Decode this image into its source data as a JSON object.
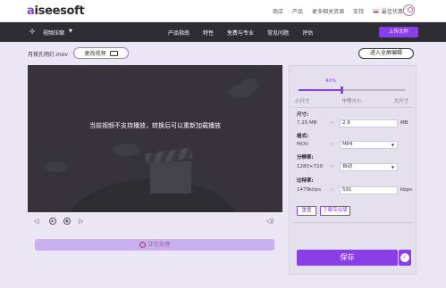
{
  "header": {
    "logo_prefix": "a",
    "logo_rest": "iseesoft",
    "nav": [
      "商店",
      "产品",
      "更多相关资源",
      "支持"
    ],
    "language": "最佳优惠"
  },
  "toolbar": {
    "tool_name": "视频压缩",
    "links": [
      "产品指南",
      "特性",
      "免费与专业",
      "常见问题",
      "评估"
    ],
    "upload_label": "上传文件"
  },
  "file": {
    "name": "月夜孔明灯.mov",
    "change_label": "更改视频",
    "fullscreen_label": "进入全屏编辑"
  },
  "video": {
    "message": "当前视频不支持播放，转换后可以重新加载播放",
    "progress_label": "正在处理"
  },
  "compression": {
    "percent_label": "40%",
    "percent_value": 0.4,
    "min_label": "小尺寸",
    "mid_label": "中等大小",
    "max_label": "大尺寸",
    "size_label": "尺寸:",
    "size_original": "7.25 MB",
    "size_value": "2.9",
    "size_unit": "MB",
    "format_label": "格式:",
    "format_original": "MOV",
    "format_value": "MP4",
    "resolution_label": "分辨率:",
    "resolution_original": "1280×720",
    "resolution_value": "自动",
    "bitrate_label": "比特率:",
    "bitrate_original": "1479kbps",
    "bitrate_value": "591",
    "bitrate_unit": "kbps",
    "reset_label": "重置",
    "download_pro_label": "下载专业版",
    "save_label": "保存"
  },
  "colors": {
    "accent": "#8a3fe6",
    "navbar": "#2e2d33",
    "video_bg": "#36343a"
  }
}
